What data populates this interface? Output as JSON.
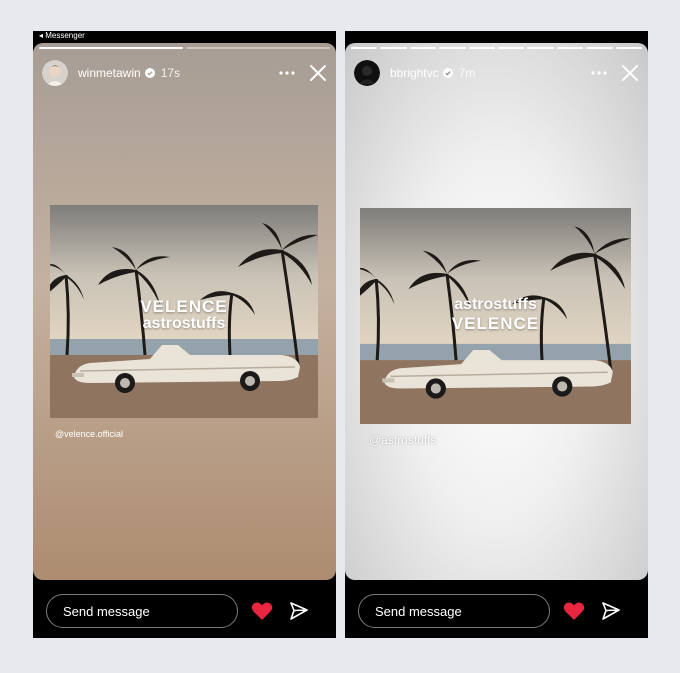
{
  "left": {
    "messenger_back": "◂ Messenger",
    "username": "winmetawin",
    "time": "17s",
    "watermark_top": "VELENCE",
    "watermark_bottom": "astrostuffs",
    "mention": "@velence.official",
    "send_placeholder": "Send message",
    "progress_segments": 2,
    "progress_done": 1
  },
  "right": {
    "username": "bbrightvc",
    "time": "7m",
    "watermark_top": "astrostuffs",
    "watermark_bottom": "VELENCE",
    "mention": "@astrostuffs",
    "send_placeholder": "Send message",
    "progress_segments": 10,
    "progress_done": 10
  },
  "colors": {
    "heart": "#e8263f",
    "verified": "#ffffff"
  }
}
